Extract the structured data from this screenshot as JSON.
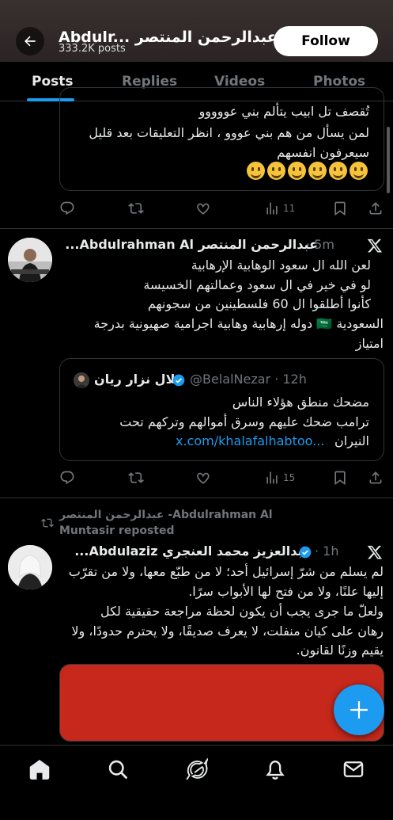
{
  "header": {
    "name": "Abdulr... عبدالرحمن المنتصر",
    "posts_count": "333.2K posts",
    "follow_label": "Follow"
  },
  "tabs": [
    {
      "label": "Posts"
    },
    {
      "label": "Replies"
    },
    {
      "label": "Videos"
    },
    {
      "label": "Photos"
    }
  ],
  "tweet1": {
    "lines": [
      "تُقصف تل ابيب يتألم بني عووووو",
      "لمن يسأل من هم بني عووو ، انظر التعليقات بعد قليل",
      "سيعرفون انفسهم"
    ],
    "views": "11"
  },
  "tweet2": {
    "author": "عبدالرحمن المنتصر Abdulrahman Al...",
    "time": "· 5m",
    "lines": [
      "لعن الله ال سعود الوهابية الإرهابية",
      "لو في خير في ال سعود وعمالتهم الخسيسة",
      "كأنوا أطلقوا ال 60 فلسطينين من سجونهم",
      "السعودية 🇸🇦 دوله إرهابية وهابية اجرامية صهيونية بدرجة",
      "امتياز"
    ],
    "quote": {
      "author": "بلال نزار ريان",
      "handle": "@BelalNezar · 12h",
      "lines": [
        "مضحك منطق هؤلاء الناس",
        "ترامب ضحك عليهم وسرق أموالهم وتركهم تحت",
        "النيران"
      ],
      "link": "x.com/khalafalhabtoo..."
    },
    "views": "15"
  },
  "tweet3": {
    "repost_line1": "عبدالرحمن المنتصر -Abdulrahman Al",
    "repost_line2": "Muntasir reposted",
    "author": "عبدالعزيز محمد العنجري Abdulaziz...",
    "time": "· 1h",
    "lines": [
      "لم يسلم من شرّ إسرائيل أحد؛ لا من طبّع معها، ولا من تقرّب",
      "إليها علنًا، ولا من فتح لها الأبواب سرًا.",
      "ولعلّ ما جرى يجب أن يكون لحظة مراجعة حقيقية لكل",
      "رهان على كيان منفلت، لا يعرف صديقًا، ولا يحترم حدودًا، ولا",
      "يقيم وزنًا لقانون."
    ]
  },
  "icons": {
    "back": "arrow-left-icon",
    "reply": "reply-icon",
    "repost": "repost-icon",
    "like": "heart-icon",
    "views": "bar-chart-icon",
    "bookmark": "bookmark-icon",
    "share": "share-icon",
    "x": "x-logo-icon",
    "verified": "verified-badge-icon",
    "compose": "plus-icon",
    "home": "home-icon",
    "search": "search-icon",
    "grok": "grok-icon",
    "notifications": "bell-icon",
    "messages": "mail-icon"
  },
  "colors": {
    "accent": "#1d9bf0",
    "background": "#000000",
    "muted": "#71767b",
    "media_card": "#c6281b"
  }
}
